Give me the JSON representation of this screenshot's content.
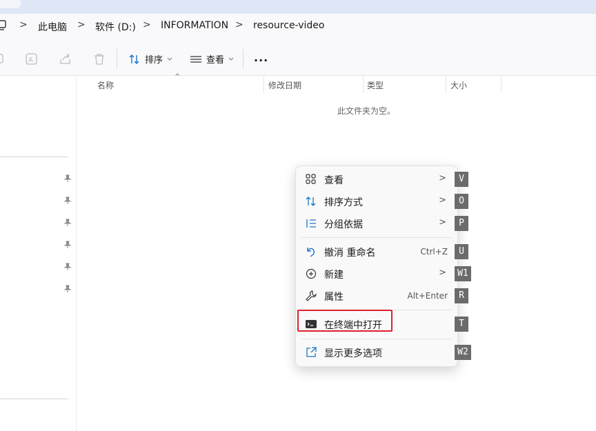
{
  "breadcrumb": {
    "items": [
      "此电脑",
      "软件 (D:)",
      "INFORMATION",
      "resource-video"
    ],
    "separator": ">"
  },
  "toolbar": {
    "sort_label": "排序",
    "view_label": "查看",
    "more_label": "..."
  },
  "columns": {
    "name": "名称",
    "modified": "修改日期",
    "type": "类型",
    "size": "大小"
  },
  "empty_message": "此文件夹为空。",
  "context_menu": {
    "items": [
      {
        "label": "查看",
        "shortcut": "",
        "submenu": true,
        "icon": "grid-view-icon",
        "access_key": "V"
      },
      {
        "label": "排序方式",
        "shortcut": "",
        "submenu": true,
        "icon": "sort-icon",
        "access_key": "O"
      },
      {
        "label": "分组依据",
        "shortcut": "",
        "submenu": true,
        "icon": "group-list-icon",
        "access_key": "P"
      },
      {
        "label": "撤消 重命名",
        "shortcut": "Ctrl+Z",
        "submenu": false,
        "icon": "undo-icon",
        "access_key": "U"
      },
      {
        "label": "新建",
        "shortcut": "",
        "submenu": true,
        "icon": "new-plus-icon",
        "access_key": "W1"
      },
      {
        "label": "属性",
        "shortcut": "Alt+Enter",
        "submenu": false,
        "icon": "wrench-icon",
        "access_key": "R"
      },
      {
        "label": "在终端中打开",
        "shortcut": "",
        "submenu": false,
        "icon": "terminal-icon",
        "access_key": "T"
      },
      {
        "label": "显示更多选项",
        "shortcut": "",
        "submenu": false,
        "icon": "external-link-icon",
        "access_key": "W2"
      }
    ],
    "submenu_arrow": ">"
  },
  "colors": {
    "accent": "#1a73c8",
    "highlight_border": "#e0202a",
    "key_badge": "#6b6b6b"
  }
}
